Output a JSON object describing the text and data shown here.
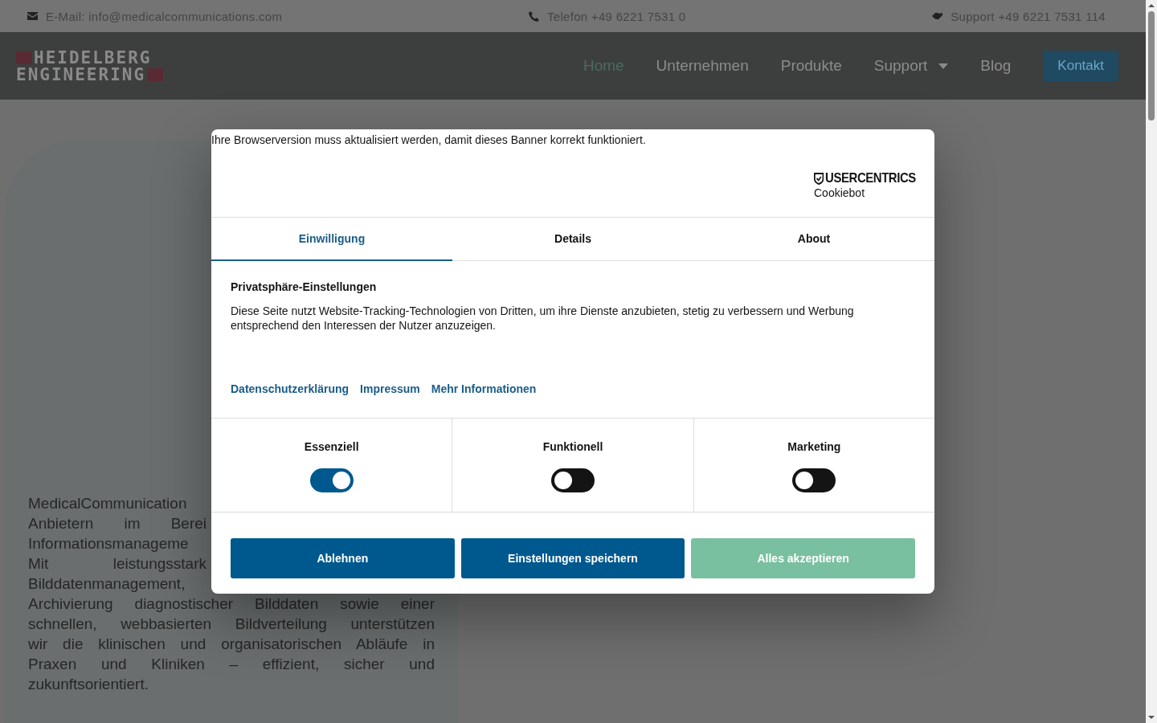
{
  "top_bar": {
    "email": "E-Mail: info@medicalcommunications.com",
    "phone": "Telefon +49 6221 7531 0",
    "support": "Support +49 6221 7531 114"
  },
  "header": {
    "logo": [
      "HEIDELBERG",
      "ENGINEERING"
    ],
    "nav": [
      {
        "label": "Home",
        "selected": true,
        "kind": "link"
      },
      {
        "label": "Unternehmen",
        "selected": false,
        "kind": "link"
      },
      {
        "label": "Produkte",
        "selected": false,
        "kind": "link"
      },
      {
        "label": "Support",
        "selected": false,
        "kind": "dropdown"
      },
      {
        "label": "Blog",
        "selected": false,
        "kind": "link"
      },
      {
        "label": "Kontakt",
        "selected": false,
        "kind": "button"
      }
    ]
  },
  "intro_lines": [
    "MedicalCommunication",
    "Anbietern im Berei",
    "Informationsmanageme",
    "Mit leistungsstark",
    "Bilddatenmanagement,",
    "Archivierung diagnostischer Bilddaten sowie einer",
    "schnellen, webbasierten Bildverteilung unterstützen",
    "wir die klinischen und organisatorischen Abläufe in",
    "Praxen und Kliniken – effizient, sicher und",
    "zukunftsorientiert."
  ],
  "cookie_dialog": {
    "notice": "Ihre Browserversion muss aktualisiert werden, damit dieses Banner korrekt funktioniert.",
    "brand": {
      "name": "USERCENTRICS",
      "product": "Cookiebot"
    },
    "tabs": [
      {
        "label": "Einwilligung",
        "selected": true
      },
      {
        "label": "Details",
        "selected": false
      },
      {
        "label": "About",
        "selected": false
      }
    ],
    "title": "Privatsphäre-Einstellungen",
    "text": "Diese Seite nutzt Website-Tracking-Technologien von Dritten, um ihre Dienste anzubieten, stetig zu verbessern und Werbung entsprechend den Interessen der Nutzer anzuzeigen.",
    "links": [
      "Datenschutzerklärung",
      "Impressum",
      "Mehr Informationen"
    ],
    "categories": [
      {
        "label": "Essenziell",
        "on": true
      },
      {
        "label": "Funktionell",
        "on": false
      },
      {
        "label": "Marketing",
        "on": false
      }
    ],
    "buttons": [
      {
        "label": "Ablehnen",
        "kind": "primary"
      },
      {
        "label": "Einstellungen speichern",
        "kind": "primary"
      },
      {
        "label": "Alles akzeptieren",
        "kind": "accept"
      }
    ]
  }
}
